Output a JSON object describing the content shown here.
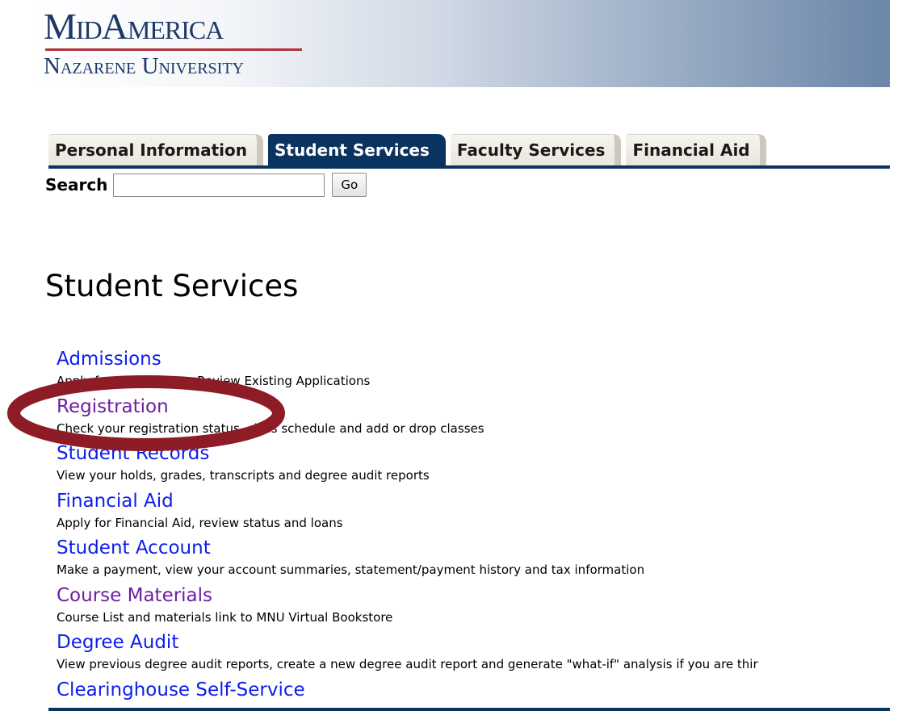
{
  "banner": {
    "logo_line1": "MidAmerica",
    "logo_line2": "Nazarene University"
  },
  "tabs": [
    {
      "label": "Personal Information",
      "active": false
    },
    {
      "label": "Student Services",
      "active": true
    },
    {
      "label": "Faculty Services",
      "active": false
    },
    {
      "label": "Financial Aid",
      "active": false
    }
  ],
  "search": {
    "label": "Search",
    "value": "",
    "button_label": "Go"
  },
  "page_title": "Student Services",
  "menu": [
    {
      "label": "Admissions",
      "description": "Apply for Admission or Review Existing Applications",
      "visited": false
    },
    {
      "label": "Registration",
      "description": "Check your registration status, class schedule and add or drop classes",
      "visited": true
    },
    {
      "label": "Student Records",
      "description": "View your holds, grades, transcripts and degree audit reports",
      "visited": false
    },
    {
      "label": "Financial Aid",
      "description": "Apply for Financial Aid, review status and loans",
      "visited": false
    },
    {
      "label": "Student Account",
      "description": "Make a payment, view your account summaries, statement/payment history and tax information",
      "visited": false
    },
    {
      "label": "Course Materials",
      "description": "Course List and materials link to MNU Virtual Bookstore",
      "visited": true
    },
    {
      "label": "Degree Audit",
      "description": "View previous degree audit reports, create a new degree audit report and generate \"what-if\" analysis if you are thir",
      "visited": false
    },
    {
      "label": "Clearinghouse Self-Service",
      "description": "",
      "visited": false
    }
  ],
  "colors": {
    "link": "#0d1ee8",
    "visited_link": "#6b1fa2",
    "nav_blue": "#0b335f",
    "annotation_circle": "#8e1c26",
    "logo_text": "#1d3768",
    "logo_rule": "#b3303f"
  }
}
